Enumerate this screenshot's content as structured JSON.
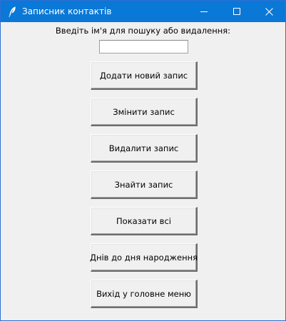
{
  "window": {
    "title": "Записник контактів",
    "icon": "feather-icon",
    "controls": {
      "minimize_icon": "minimize-icon",
      "maximize_icon": "maximize-icon",
      "close_icon": "close-icon"
    },
    "titlebar_color": "#0a78d7"
  },
  "search": {
    "label": "Введіть ім'я для пошуку або видалення:",
    "value": "",
    "placeholder": ""
  },
  "buttons": {
    "add": "Додати новий запис",
    "edit": "Змінити запис",
    "delete": "Видалити запис",
    "find": "Знайти запис",
    "show_all": "Показати всі",
    "birthday": "Днів до дня народження",
    "exit": "Вихід у головне меню"
  }
}
